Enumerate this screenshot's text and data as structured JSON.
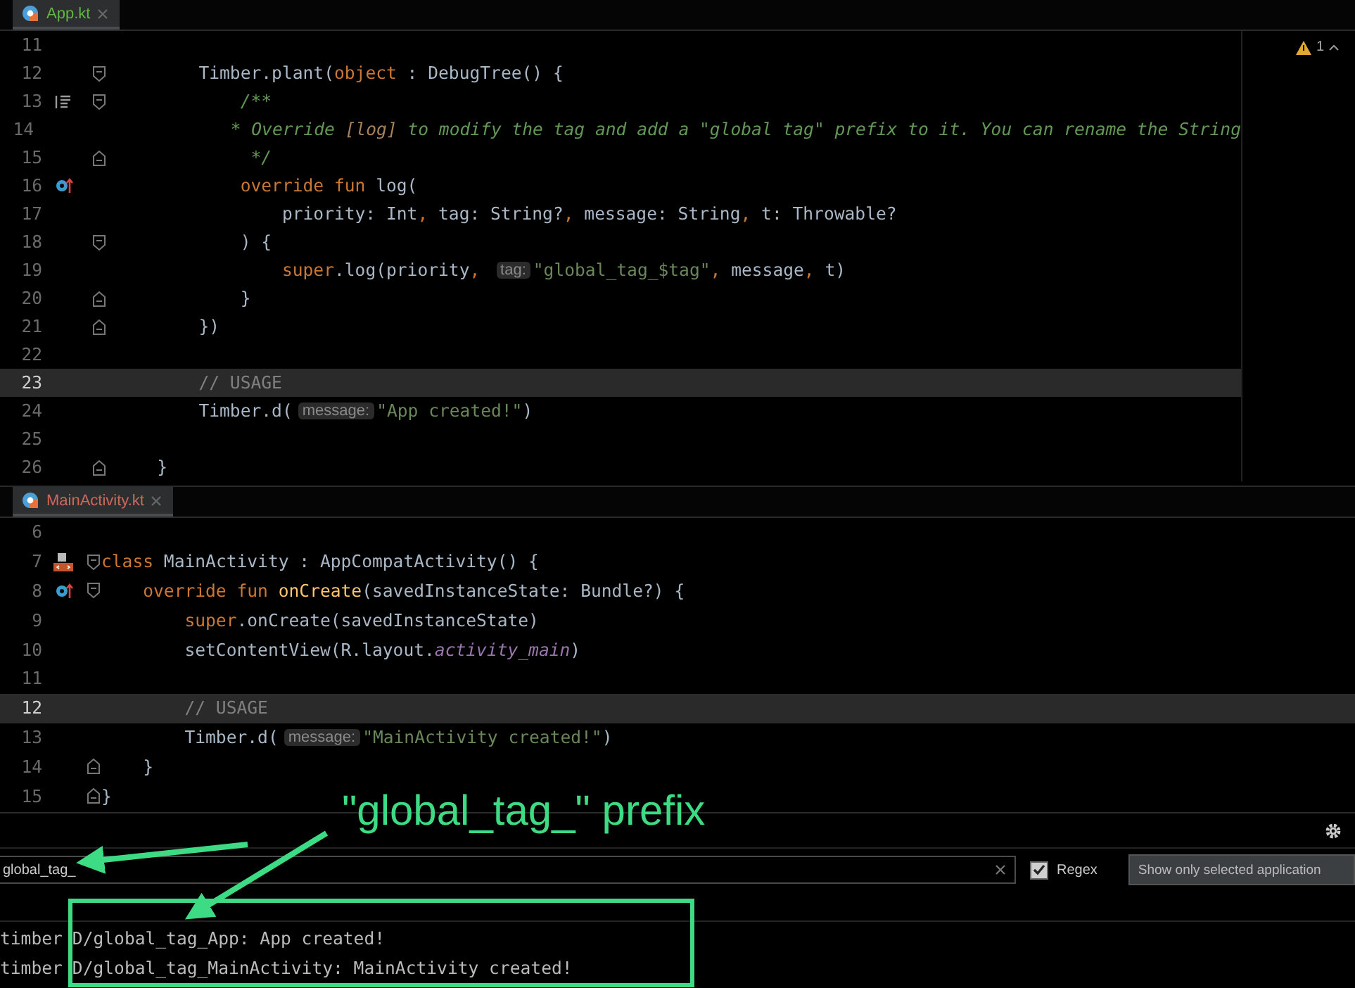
{
  "top_editor": {
    "tab": {
      "label": "App.kt",
      "color": "#62b543",
      "selected": true
    },
    "warnings": {
      "count": "1"
    },
    "lines": [
      {
        "number": "11",
        "current": false
      },
      {
        "number": "12",
        "current": false,
        "markers": [
          {
            "kind": "fold-start"
          }
        ],
        "tokens": [
          {
            "kind": "plain",
            "t": "        Timber.plant("
          },
          {
            "kind": "kw",
            "t": "object"
          },
          {
            "kind": "plain",
            "t": " : DebugTree() {"
          }
        ]
      },
      {
        "number": "13",
        "current": false,
        "markers": [
          {
            "kind": "doc"
          },
          {
            "kind": "fold-start"
          }
        ],
        "tokens": [
          {
            "kind": "comment",
            "t": "            /**"
          }
        ]
      },
      {
        "number": "14",
        "current": false,
        "tokens": [
          {
            "kind": "comment",
            "t": "             * Override "
          },
          {
            "kind": "docref",
            "t": "[log]"
          },
          {
            "kind": "comment",
            "t": " to modify the tag and add a \"global tag\" prefix to it. You can rename the String"
          }
        ]
      },
      {
        "number": "15",
        "current": false,
        "markers": [
          {
            "kind": "fold-end"
          }
        ],
        "tokens": [
          {
            "kind": "comment",
            "t": "             */"
          }
        ]
      },
      {
        "number": "16",
        "current": false,
        "markers": [
          {
            "kind": "override"
          }
        ],
        "tokens": [
          {
            "kind": "kw",
            "t": "            override fun "
          },
          {
            "kind": "plain",
            "t": "log("
          }
        ]
      },
      {
        "number": "17",
        "current": false,
        "tokens": [
          {
            "kind": "plain",
            "t": "                priority: Int"
          },
          {
            "kind": "kw",
            "t": ","
          },
          {
            "kind": "plain",
            "t": " tag: String?"
          },
          {
            "kind": "kw",
            "t": ","
          },
          {
            "kind": "plain",
            "t": " message: String"
          },
          {
            "kind": "kw",
            "t": ","
          },
          {
            "kind": "plain",
            "t": " t: Throwable?"
          }
        ]
      },
      {
        "number": "18",
        "current": false,
        "markers": [
          {
            "kind": "fold-start"
          }
        ],
        "tokens": [
          {
            "kind": "plain",
            "t": "            ) {"
          }
        ]
      },
      {
        "number": "19",
        "current": false,
        "tokens": [
          {
            "kind": "kw",
            "t": "                super"
          },
          {
            "kind": "plain",
            "t": ".log(priority"
          },
          {
            "kind": "kw",
            "t": ", "
          },
          {
            "kind": "hint",
            "t": "tag:"
          },
          {
            "kind": "str",
            "t": "\"global_tag_$tag\""
          },
          {
            "kind": "kw",
            "t": ","
          },
          {
            "kind": "plain",
            "t": " message"
          },
          {
            "kind": "kw",
            "t": ","
          },
          {
            "kind": "plain",
            "t": " t)"
          }
        ]
      },
      {
        "number": "20",
        "current": false,
        "markers": [
          {
            "kind": "fold-end"
          }
        ],
        "tokens": [
          {
            "kind": "plain",
            "t": "            }"
          }
        ]
      },
      {
        "number": "21",
        "current": false,
        "markers": [
          {
            "kind": "fold-end"
          }
        ],
        "tokens": [
          {
            "kind": "plain",
            "t": "        })"
          }
        ]
      },
      {
        "number": "22",
        "current": false
      },
      {
        "number": "23",
        "current": true,
        "tokens": [
          {
            "kind": "linecomment",
            "t": "        // USAGE"
          }
        ]
      },
      {
        "number": "24",
        "current": false,
        "tokens": [
          {
            "kind": "plain",
            "t": "        Timber.d("
          },
          {
            "kind": "hint",
            "t": "message:"
          },
          {
            "kind": "str",
            "t": "\"App created!\""
          },
          {
            "kind": "plain",
            "t": ")"
          }
        ]
      },
      {
        "number": "25",
        "current": false
      },
      {
        "number": "26",
        "current": false,
        "markers": [
          {
            "kind": "fold-end"
          }
        ],
        "tokens": [
          {
            "kind": "plain",
            "t": "    }"
          }
        ]
      }
    ]
  },
  "bottom_editor": {
    "tab": {
      "label": "MainActivity.kt",
      "color": "#d1675a",
      "selected": true
    },
    "lines": [
      {
        "number": "6",
        "current": false
      },
      {
        "number": "7",
        "current": false,
        "markers": [
          {
            "kind": "layout"
          },
          {
            "kind": "fold-start"
          }
        ],
        "tokens": [
          {
            "kind": "kw",
            "t": "class "
          },
          {
            "kind": "plain",
            "t": "MainActivity : AppCompatActivity() {"
          }
        ]
      },
      {
        "number": "8",
        "current": false,
        "markers": [
          {
            "kind": "override"
          },
          {
            "kind": "fold-start"
          }
        ],
        "tokens": [
          {
            "kind": "kw",
            "t": "    override fun "
          },
          {
            "kind": "fn",
            "t": "onCreate"
          },
          {
            "kind": "plain",
            "t": "(savedInstanceState: Bundle?) {"
          }
        ]
      },
      {
        "number": "9",
        "current": false,
        "tokens": [
          {
            "kind": "kw",
            "t": "        super"
          },
          {
            "kind": "plain",
            "t": ".onCreate(savedInstanceState)"
          }
        ]
      },
      {
        "number": "10",
        "current": false,
        "tokens": [
          {
            "kind": "plain",
            "t": "        setContentView(R.layout."
          },
          {
            "kind": "field",
            "t": "activity_main"
          },
          {
            "kind": "plain",
            "t": ")"
          }
        ]
      },
      {
        "number": "11",
        "current": false
      },
      {
        "number": "12",
        "current": true,
        "tokens": [
          {
            "kind": "linecomment",
            "t": "        // USAGE"
          }
        ]
      },
      {
        "number": "13",
        "current": false,
        "tokens": [
          {
            "kind": "plain",
            "t": "        Timber.d("
          },
          {
            "kind": "hint",
            "t": "message:"
          },
          {
            "kind": "str",
            "t": "\"MainActivity created!\""
          },
          {
            "kind": "plain",
            "t": ")"
          }
        ]
      },
      {
        "number": "14",
        "current": false,
        "markers": [
          {
            "kind": "fold-end"
          }
        ],
        "tokens": [
          {
            "kind": "plain",
            "t": "    }"
          }
        ]
      },
      {
        "number": "15",
        "current": false,
        "markers": [
          {
            "kind": "fold-end"
          }
        ],
        "tokens": [
          {
            "kind": "plain",
            "t": "}"
          }
        ]
      }
    ]
  },
  "logcat": {
    "filter": {
      "value": "global_tag_"
    },
    "regex": {
      "label": "Regex",
      "checked": true
    },
    "app_filter": {
      "value": "Show only selected application"
    },
    "entries": [
      {
        "tag": "timber",
        "message": "D/global_tag_App: App created!"
      },
      {
        "tag": "timber",
        "message": "D/global_tag_MainActivity: MainActivity created!"
      }
    ]
  },
  "annotation": {
    "label": "\"global_tag_\" prefix"
  }
}
